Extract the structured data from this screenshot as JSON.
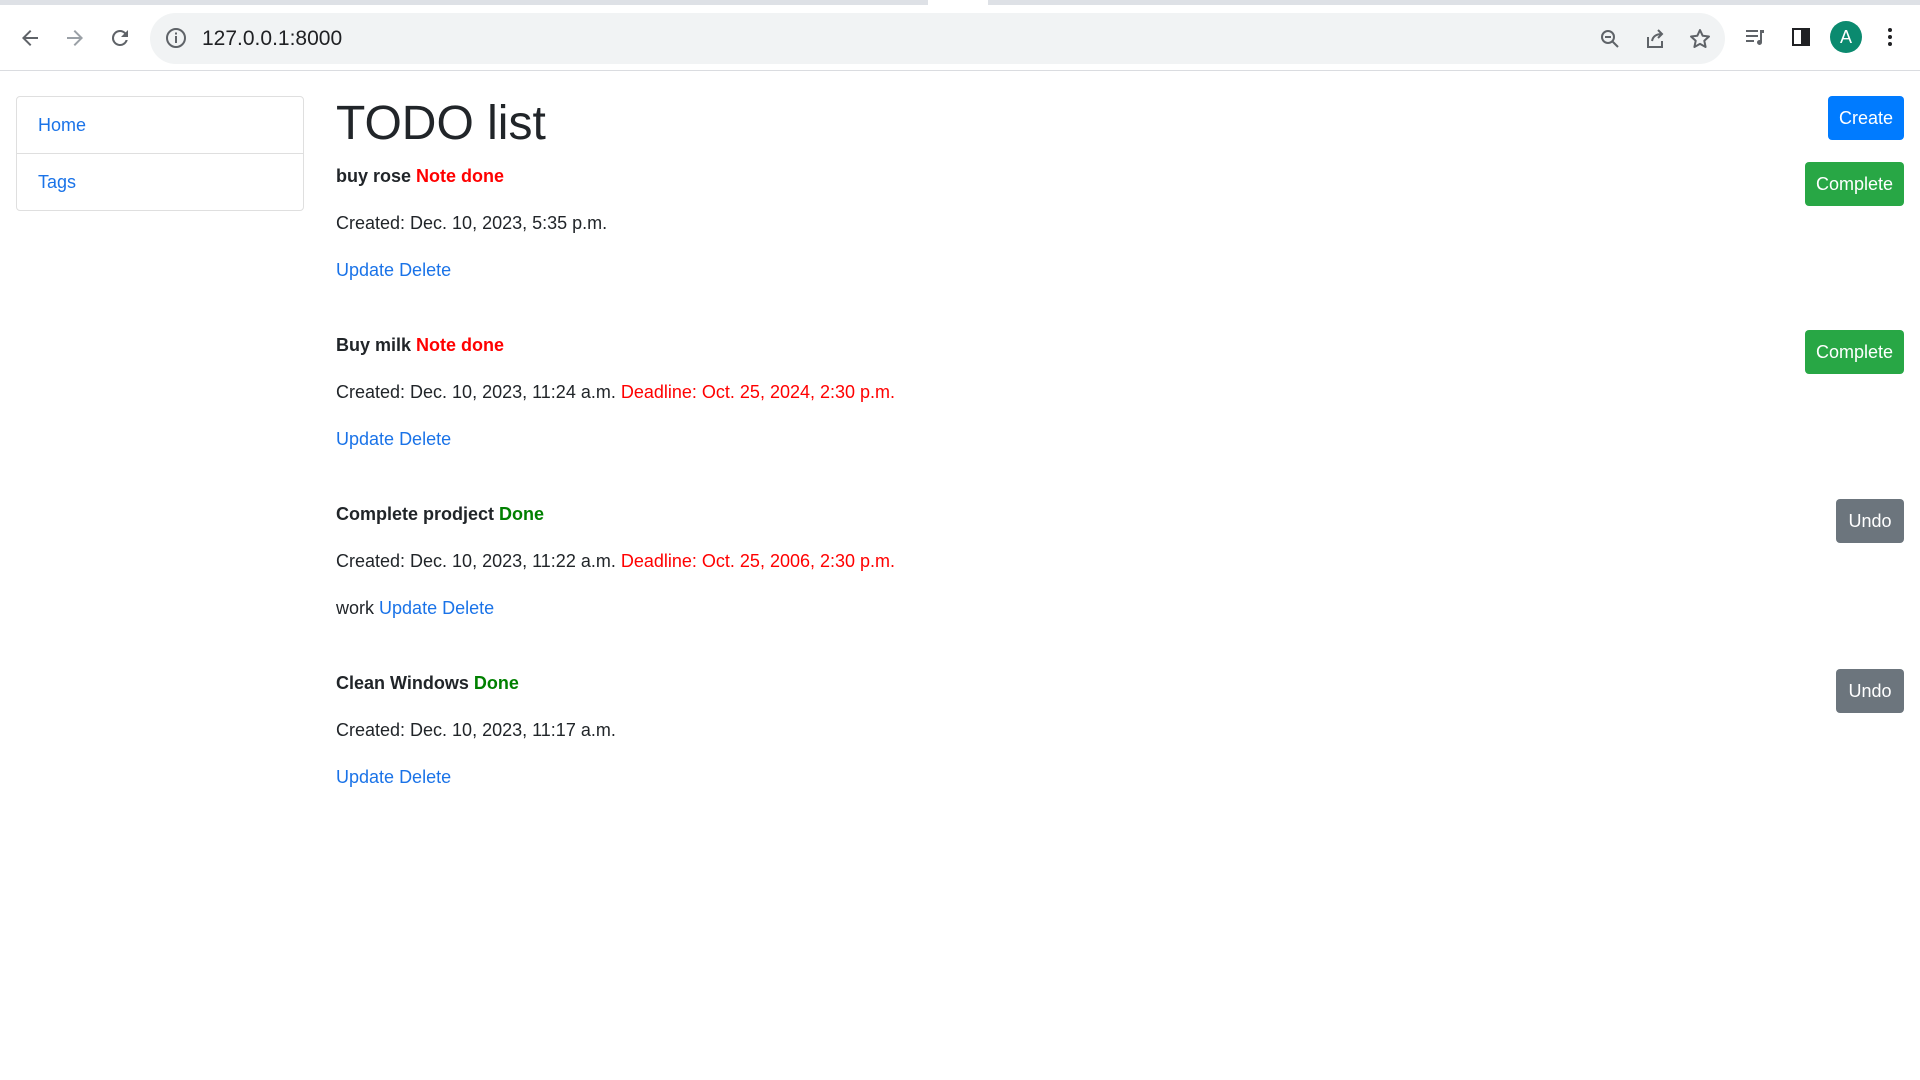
{
  "browser": {
    "url": "127.0.0.1:8000",
    "avatar_letter": "A",
    "icons": [
      "back-arrow-icon",
      "forward-arrow-icon",
      "reload-icon",
      "info-icon",
      "zoom-icon",
      "share-icon",
      "star-icon",
      "reading-list-icon",
      "side-panel-icon",
      "more-vert-icon"
    ]
  },
  "sidebar": {
    "items": [
      {
        "label": "Home"
      },
      {
        "label": "Tags"
      }
    ]
  },
  "main": {
    "title": "TODO list",
    "create_label": "Create"
  },
  "todos": [
    {
      "name": "buy rose",
      "status": "Note done",
      "created": "Created: Dec. 10, 2023, 5:35 p.m.",
      "deadline": "",
      "tags": "",
      "update_label": "Update",
      "delete_label": "Delete",
      "action_label": "Complete"
    },
    {
      "name": "Buy milk",
      "status": "Note done",
      "created": "Created: Dec. 10, 2023, 11:24 a.m.",
      "deadline": "Deadline: Oct. 25, 2024, 2:30 p.m.",
      "tags": "",
      "update_label": "Update",
      "delete_label": "Delete",
      "action_label": "Complete"
    },
    {
      "name": "Complete prodject",
      "status": "Done",
      "created": "Created: Dec. 10, 2023, 11:22 a.m.",
      "deadline": "Deadline: Oct. 25, 2006, 2:30 p.m.",
      "tags": "work",
      "update_label": "Update",
      "delete_label": "Delete",
      "action_label": "Undo"
    },
    {
      "name": "Clean Windows",
      "status": "Done",
      "created": "Created: Dec. 10, 2023, 11:17 a.m.",
      "deadline": "",
      "tags": "",
      "update_label": "Update",
      "delete_label": "Delete",
      "action_label": "Undo"
    }
  ],
  "colors": {
    "link": "#1a73e8",
    "not_done": "#ff0000",
    "done": "#008000",
    "create_button": "#007bff",
    "complete_button": "#28a745",
    "undo_button": "#6c757d",
    "avatar": "#0b8a6f"
  }
}
